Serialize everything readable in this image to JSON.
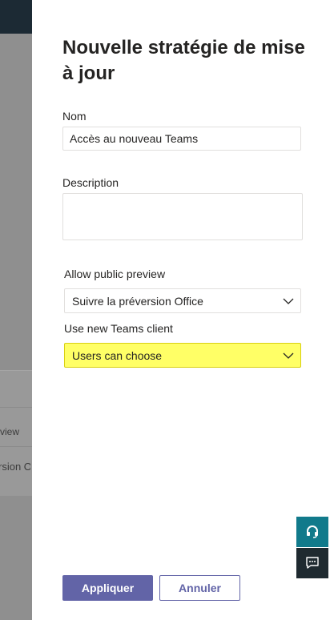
{
  "background": {
    "column_header_fragment": "view",
    "row_value_fragment": "rsion O"
  },
  "panel": {
    "title": "Nouvelle stratégie de mise à jour",
    "name_field": {
      "label": "Nom",
      "value": "Accès au nouveau Teams"
    },
    "description_field": {
      "label": "Description",
      "value": ""
    },
    "public_preview": {
      "label": "Allow public preview",
      "selected": "Suivre la préversion Office"
    },
    "new_teams_client": {
      "label": "Use new Teams client",
      "selected": "Users can choose",
      "highlight_color": "#ffff66"
    },
    "buttons": {
      "apply_label": "Appliquer",
      "cancel_label": "Annuler"
    }
  },
  "colors": {
    "accent": "#6264a7",
    "help_widget": "#117a8b",
    "feedback_widget": "#1f2a30"
  },
  "icons": {
    "help": "headset-icon",
    "feedback": "chat-feedback-icon",
    "dropdown": "chevron-down-icon"
  }
}
